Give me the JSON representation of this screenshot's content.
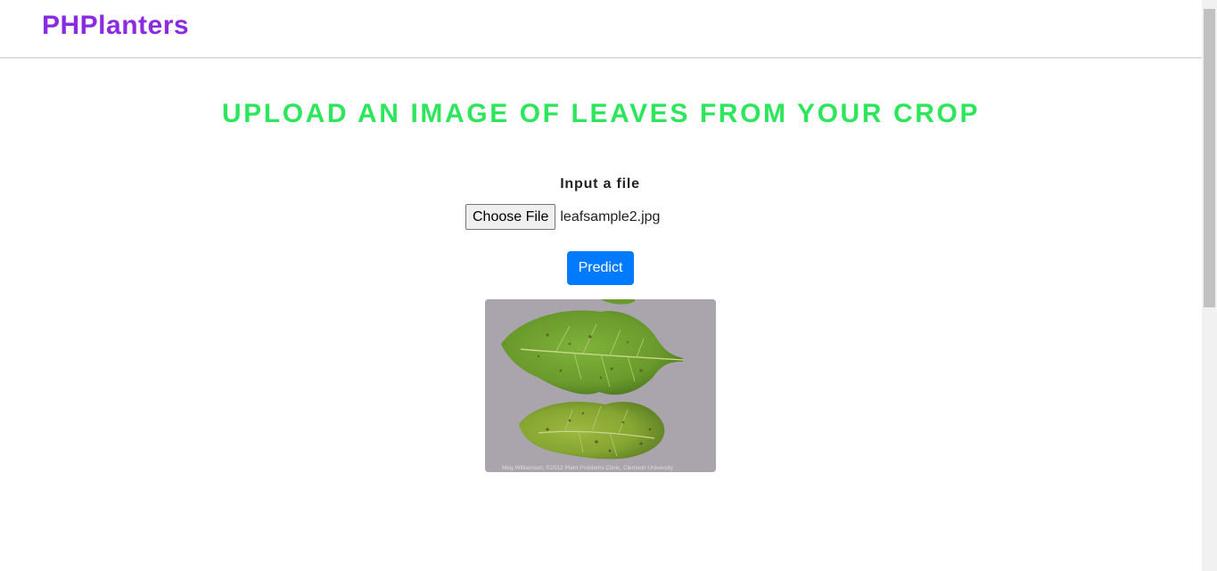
{
  "navbar": {
    "brand": "PHPlanters"
  },
  "main": {
    "heading": "UPLOAD AN IMAGE OF LEAVES FROM YOUR CROP",
    "file_label": "Input a file",
    "choose_file_label": "Choose File",
    "selected_file": "leafsample2.jpg",
    "predict_label": "Predict"
  },
  "preview": {
    "caption": "Meg Williamson, ©2012 Plant Problems Clinic, Clemson University"
  },
  "colors": {
    "brand": "#8a2be2",
    "heading": "#2ee65b",
    "primary_button": "#007bff"
  }
}
